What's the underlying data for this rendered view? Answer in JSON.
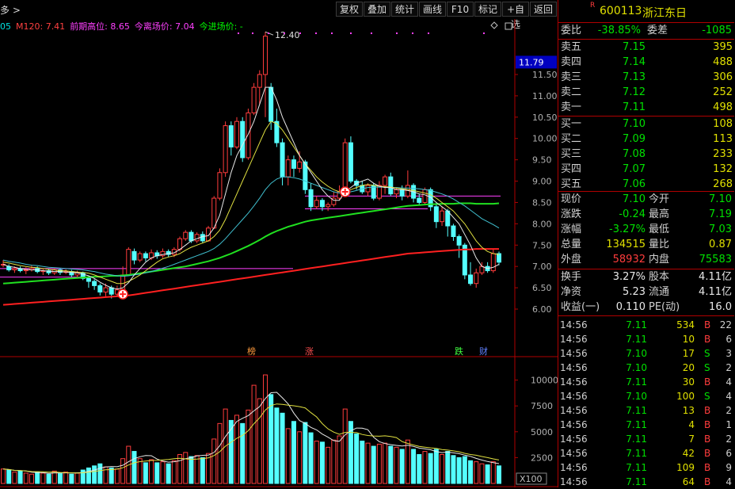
{
  "toolbar": {
    "left_text": "多 >",
    "buttons": [
      "复权",
      "叠加",
      "统计",
      "画线",
      "F10",
      "标记",
      "+自选",
      "返回"
    ]
  },
  "legend": [
    {
      "text": "05",
      "color": "#00e0e0"
    },
    {
      "text": "M120: 7.41",
      "color": "#ff4040"
    },
    {
      "text": "前期高位: 8.65",
      "color": "#ff40ff"
    },
    {
      "text": "今离场价: 7.04",
      "color": "#ff40ff"
    },
    {
      "text": "今进场价: -",
      "color": "#00ff00"
    }
  ],
  "main_chart": {
    "y_ticks": [
      11.5,
      11.0,
      10.5,
      10.0,
      9.5,
      9.0,
      8.5,
      8.0,
      7.5,
      7.0,
      6.5,
      6.0
    ],
    "current_price_label": "11.79",
    "peak_label": "12.40",
    "event_markers": [
      {
        "text": "榜",
        "color": "#ff9a3c"
      },
      {
        "text": "涨",
        "color": "#ff5050"
      },
      {
        "text": "跌",
        "color": "#40ff40"
      },
      {
        "text": "财",
        "color": "#6080ff"
      }
    ],
    "candles": [
      [
        7.05,
        7.05,
        7.15,
        6.98
      ],
      [
        7.0,
        6.92,
        7.05,
        6.88
      ],
      [
        6.92,
        6.95,
        7.0,
        6.85
      ],
      [
        6.95,
        6.9,
        7.0,
        6.86
      ],
      [
        6.9,
        6.92,
        6.98,
        6.82
      ],
      [
        6.92,
        6.95,
        7.02,
        6.88
      ],
      [
        6.95,
        6.88,
        7.0,
        6.84
      ],
      [
        6.88,
        6.9,
        6.95,
        6.8
      ],
      [
        6.9,
        6.85,
        6.95,
        6.8
      ],
      [
        6.85,
        6.92,
        6.97,
        6.8
      ],
      [
        6.92,
        6.86,
        6.95,
        6.8
      ],
      [
        6.86,
        6.88,
        6.93,
        6.82
      ],
      [
        6.88,
        6.8,
        6.92,
        6.75
      ],
      [
        6.8,
        6.85,
        6.9,
        6.74
      ],
      [
        6.85,
        6.72,
        6.88,
        6.68
      ],
      [
        6.72,
        6.65,
        6.78,
        6.5
      ],
      [
        6.65,
        6.55,
        6.7,
        6.45
      ],
      [
        6.55,
        6.4,
        6.6,
        6.32
      ],
      [
        6.4,
        6.5,
        6.6,
        6.3
      ],
      [
        6.5,
        6.35,
        6.55,
        6.25
      ],
      [
        6.35,
        6.45,
        6.55,
        6.3
      ],
      [
        6.45,
        6.8,
        7.0,
        6.4
      ],
      [
        6.8,
        7.4,
        7.45,
        6.78
      ],
      [
        7.35,
        7.15,
        7.42,
        7.05
      ],
      [
        7.15,
        7.3,
        7.35,
        7.1
      ],
      [
        7.3,
        7.2,
        7.35,
        7.12
      ],
      [
        7.2,
        7.32,
        7.4,
        7.15
      ],
      [
        7.32,
        7.25,
        7.38,
        7.18
      ],
      [
        7.25,
        7.35,
        7.42,
        7.2
      ],
      [
        7.35,
        7.28,
        7.4,
        7.22
      ],
      [
        7.28,
        7.4,
        7.45,
        7.22
      ],
      [
        7.4,
        7.65,
        7.7,
        7.35
      ],
      [
        7.65,
        7.8,
        7.85,
        7.6
      ],
      [
        7.8,
        7.6,
        7.85,
        7.55
      ],
      [
        7.6,
        7.75,
        7.8,
        7.55
      ],
      [
        7.75,
        7.6,
        7.82,
        7.55
      ],
      [
        7.6,
        7.9,
        7.95,
        7.58
      ],
      [
        7.9,
        8.6,
        8.65,
        7.88
      ],
      [
        8.6,
        9.2,
        9.3,
        8.55
      ],
      [
        9.2,
        10.3,
        10.4,
        9.1
      ],
      [
        10.3,
        9.8,
        10.4,
        9.6
      ],
      [
        9.8,
        10.4,
        10.5,
        9.75
      ],
      [
        10.4,
        9.55,
        10.5,
        9.45
      ],
      [
        9.55,
        10.6,
        10.7,
        9.5
      ],
      [
        10.6,
        11.2,
        11.3,
        10.55
      ],
      [
        11.2,
        11.5,
        11.6,
        10.8
      ],
      [
        11.5,
        12.4,
        12.5,
        10.5
      ],
      [
        11.2,
        10.4,
        11.3,
        10.2
      ],
      [
        10.4,
        9.9,
        10.7,
        9.8
      ],
      [
        9.9,
        9.1,
        10.0,
        8.9
      ],
      [
        9.1,
        9.5,
        9.6,
        8.9
      ],
      [
        9.5,
        9.3,
        9.6,
        9.1
      ],
      [
        9.3,
        9.45,
        9.7,
        9.2
      ],
      [
        9.45,
        8.8,
        9.5,
        8.7
      ],
      [
        8.8,
        8.4,
        8.95,
        8.3
      ],
      [
        8.4,
        8.55,
        8.65,
        8.35
      ],
      [
        8.55,
        8.4,
        8.6,
        8.3
      ],
      [
        8.4,
        8.45,
        8.5,
        8.3
      ],
      [
        8.45,
        8.6,
        8.75,
        8.4
      ],
      [
        8.6,
        8.75,
        8.9,
        8.55
      ],
      [
        8.75,
        9.9,
        10.0,
        8.7
      ],
      [
        9.9,
        9.0,
        10.05,
        8.95
      ],
      [
        9.0,
        8.9,
        9.05,
        8.8
      ],
      [
        8.9,
        8.75,
        9.0,
        8.7
      ],
      [
        8.75,
        8.9,
        8.95,
        8.65
      ],
      [
        8.9,
        8.6,
        8.95,
        8.55
      ],
      [
        8.6,
        8.9,
        9.0,
        8.55
      ],
      [
        8.9,
        9.1,
        9.15,
        8.7
      ],
      [
        9.1,
        8.7,
        9.2,
        8.65
      ],
      [
        8.7,
        8.8,
        8.85,
        8.6
      ],
      [
        8.8,
        8.65,
        8.9,
        8.55
      ],
      [
        8.65,
        8.9,
        9.25,
        8.6
      ],
      [
        8.9,
        8.6,
        8.95,
        8.5
      ],
      [
        8.6,
        8.5,
        8.7,
        8.45
      ],
      [
        8.5,
        8.8,
        8.85,
        8.45
      ],
      [
        8.8,
        8.4,
        8.85,
        8.3
      ],
      [
        8.4,
        8.05,
        8.5,
        7.9
      ],
      [
        8.05,
        8.3,
        8.4,
        7.95
      ],
      [
        8.3,
        7.95,
        8.35,
        7.7
      ],
      [
        7.95,
        7.7,
        8.0,
        7.6
      ],
      [
        7.7,
        7.5,
        7.75,
        7.2
      ],
      [
        7.5,
        6.8,
        7.55,
        6.7
      ],
      [
        6.8,
        6.6,
        7.1,
        6.55
      ],
      [
        6.6,
        6.85,
        6.95,
        6.5
      ],
      [
        6.85,
        7.0,
        7.1,
        6.8
      ],
      [
        7.0,
        6.9,
        7.1,
        6.85
      ],
      [
        6.9,
        7.3,
        7.42,
        6.85
      ],
      [
        7.3,
        7.1,
        7.35,
        7.03
      ]
    ],
    "ma_white": [
      7.05,
      7.0,
      6.98,
      6.95,
      6.93,
      6.92,
      6.92,
      6.9,
      6.89,
      6.88,
      6.88,
      6.87,
      6.86,
      6.85,
      6.82,
      6.78,
      6.72,
      6.63,
      6.56,
      6.5,
      6.47,
      6.5,
      6.62,
      6.8,
      6.95,
      7.1,
      7.2,
      7.25,
      7.28,
      7.3,
      7.32,
      7.4,
      7.5,
      7.6,
      7.65,
      7.7,
      7.72,
      7.9,
      8.2,
      8.7,
      9.2,
      9.6,
      9.85,
      10.1,
      10.4,
      10.8,
      11.2,
      11.2,
      10.9,
      10.5,
      10.2,
      9.9,
      9.6,
      9.4,
      9.2,
      9.0,
      8.8,
      8.65,
      8.55,
      8.55,
      8.75,
      8.85,
      8.95,
      9.0,
      9.05,
      8.95,
      8.88,
      8.85,
      8.85,
      8.8,
      8.8,
      8.78,
      8.75,
      8.7,
      8.68,
      8.62,
      8.5,
      8.4,
      8.3,
      8.15,
      8.0,
      7.75,
      7.5,
      7.2,
      7.0,
      6.95,
      6.98,
      7.05
    ],
    "ma_yellow": [
      7.1,
      7.08,
      7.05,
      7.02,
      7.0,
      6.98,
      6.97,
      6.95,
      6.93,
      6.92,
      6.9,
      6.9,
      6.88,
      6.87,
      6.86,
      6.84,
      6.8,
      6.75,
      6.7,
      6.65,
      6.6,
      6.6,
      6.65,
      6.72,
      6.8,
      6.9,
      7.0,
      7.1,
      7.18,
      7.22,
      7.25,
      7.3,
      7.38,
      7.45,
      7.5,
      7.55,
      7.6,
      7.7,
      7.85,
      8.1,
      8.4,
      8.7,
      9.0,
      9.3,
      9.6,
      9.9,
      10.2,
      10.4,
      10.35,
      10.2,
      10.0,
      9.8,
      9.6,
      9.4,
      9.25,
      9.1,
      8.98,
      8.88,
      8.8,
      8.75,
      8.78,
      8.8,
      8.85,
      8.9,
      8.92,
      8.9,
      8.88,
      8.87,
      8.86,
      8.84,
      8.82,
      8.8,
      8.78,
      8.75,
      8.72,
      8.68,
      8.6,
      8.5,
      8.4,
      8.3,
      8.15,
      8.0,
      7.8,
      7.6,
      7.45,
      7.35,
      7.3,
      7.28
    ],
    "ma_cyan": [
      7.15,
      7.12,
      7.1,
      7.08,
      7.05,
      7.03,
      7.02,
      7.0,
      6.98,
      6.97,
      6.96,
      6.95,
      6.94,
      6.93,
      6.92,
      6.9,
      6.88,
      6.85,
      6.82,
      6.8,
      6.78,
      6.77,
      6.78,
      6.8,
      6.82,
      6.85,
      6.88,
      6.92,
      6.96,
      7.0,
      7.05,
      7.1,
      7.15,
      7.2,
      7.25,
      7.3,
      7.35,
      7.42,
      7.52,
      7.65,
      7.8,
      7.95,
      8.1,
      8.25,
      8.42,
      8.6,
      8.8,
      8.95,
      9.05,
      9.1,
      9.1,
      9.08,
      9.05,
      9.0,
      8.95,
      8.9,
      8.85,
      8.8,
      8.75,
      8.72,
      8.72,
      8.75,
      8.78,
      8.82,
      8.85,
      8.86,
      8.86,
      8.86,
      8.85,
      8.85,
      8.84,
      8.84,
      8.83,
      8.82,
      8.8,
      8.78,
      8.74,
      8.7,
      8.65,
      8.58,
      8.5,
      8.42,
      8.32,
      8.22,
      8.12,
      8.05,
      7.98,
      7.9
    ],
    "ma_green": [
      6.6,
      6.61,
      6.62,
      6.63,
      6.64,
      6.65,
      6.66,
      6.67,
      6.68,
      6.69,
      6.7,
      6.71,
      6.72,
      6.73,
      6.74,
      6.75,
      6.76,
      6.76,
      6.77,
      6.78,
      6.78,
      6.79,
      6.8,
      6.82,
      6.84,
      6.86,
      6.88,
      6.9,
      6.92,
      6.94,
      6.96,
      6.98,
      7.0,
      7.03,
      7.06,
      7.09,
      7.12,
      7.16,
      7.2,
      7.25,
      7.3,
      7.36,
      7.42,
      7.48,
      7.55,
      7.62,
      7.7,
      7.77,
      7.83,
      7.88,
      7.93,
      7.97,
      8.01,
      8.05,
      8.08,
      8.1,
      8.12,
      8.14,
      8.16,
      8.18,
      8.2,
      8.22,
      8.24,
      8.26,
      8.28,
      8.3,
      8.32,
      8.34,
      8.36,
      8.38,
      8.4,
      8.42,
      8.43,
      8.44,
      8.45,
      8.46,
      8.46,
      8.47,
      8.47,
      8.47,
      8.48,
      8.48,
      8.48,
      8.47,
      8.47,
      8.47,
      8.47,
      8.48
    ],
    "ma_red": [
      6.1,
      6.11,
      6.12,
      6.13,
      6.14,
      6.15,
      6.16,
      6.17,
      6.18,
      6.19,
      6.2,
      6.21,
      6.22,
      6.23,
      6.24,
      6.25,
      6.26,
      6.27,
      6.28,
      6.29,
      6.3,
      6.31,
      6.32,
      6.34,
      6.36,
      6.38,
      6.4,
      6.42,
      6.44,
      6.46,
      6.48,
      6.5,
      6.52,
      6.54,
      6.56,
      6.58,
      6.6,
      6.62,
      6.64,
      6.66,
      6.68,
      6.7,
      6.72,
      6.74,
      6.76,
      6.78,
      6.8,
      6.82,
      6.84,
      6.86,
      6.88,
      6.9,
      6.92,
      6.94,
      6.96,
      6.98,
      7.0,
      7.02,
      7.04,
      7.06,
      7.08,
      7.1,
      7.12,
      7.14,
      7.16,
      7.18,
      7.2,
      7.22,
      7.24,
      7.26,
      7.28,
      7.3,
      7.31,
      7.32,
      7.33,
      7.34,
      7.35,
      7.36,
      7.37,
      7.38,
      7.39,
      7.4,
      7.4,
      7.41,
      7.41,
      7.41,
      7.41,
      7.41
    ]
  },
  "volume_chart": {
    "y_ticks": [
      10000,
      7500,
      5000,
      2500
    ],
    "unit_label": "X100",
    "values": [
      1400,
      1300,
      1100,
      1200,
      1000,
      900,
      1100,
      1000,
      900,
      1200,
      950,
      1100,
      900,
      1000,
      1300,
      1500,
      1700,
      1900,
      1600,
      1500,
      1400,
      2400,
      3600,
      3100,
      2400,
      2000,
      2300,
      2000,
      2100,
      1900,
      2200,
      2800,
      3000,
      2600,
      2700,
      2500,
      2900,
      4300,
      5800,
      7200,
      6100,
      6600,
      5800,
      7100,
      9500,
      8200,
      10500,
      8600,
      7300,
      6800,
      5300,
      6000,
      5000,
      5900,
      4900,
      4100,
      4000,
      3500,
      4200,
      4600,
      7200,
      6000,
      4800,
      4100,
      3900,
      3600,
      3800,
      3900,
      3600,
      3500,
      3300,
      4200,
      3300,
      2800,
      3100,
      2900,
      3300,
      2800,
      3100,
      2700,
      2500,
      2600,
      2200,
      2100,
      1900,
      1800,
      2100,
      1700
    ]
  },
  "quote": {
    "code": "600113",
    "name": "浙江东日",
    "tag": "R",
    "webi": {
      "label": "委比",
      "value": "-38.85%",
      "label2": "委差",
      "value2": "-1085"
    },
    "asks": [
      {
        "l": "卖五",
        "p": "7.15",
        "v": "395"
      },
      {
        "l": "卖四",
        "p": "7.14",
        "v": "488"
      },
      {
        "l": "卖三",
        "p": "7.13",
        "v": "306"
      },
      {
        "l": "卖二",
        "p": "7.12",
        "v": "252"
      },
      {
        "l": "卖一",
        "p": "7.11",
        "v": "498"
      }
    ],
    "bids": [
      {
        "l": "买一",
        "p": "7.10",
        "v": "108"
      },
      {
        "l": "买二",
        "p": "7.09",
        "v": "113"
      },
      {
        "l": "买三",
        "p": "7.08",
        "v": "233"
      },
      {
        "l": "买四",
        "p": "7.07",
        "v": "132"
      },
      {
        "l": "买五",
        "p": "7.06",
        "v": "268"
      }
    ],
    "stats": [
      {
        "l": "现价",
        "v": "7.10",
        "c": "green",
        "l2": "今开",
        "v2": "7.10",
        "c2": "green"
      },
      {
        "l": "涨跌",
        "v": "-0.24",
        "c": "green",
        "l2": "最高",
        "v2": "7.19",
        "c2": "green"
      },
      {
        "l": "涨幅",
        "v": "-3.27%",
        "c": "green",
        "l2": "最低",
        "v2": "7.03",
        "c2": "green"
      },
      {
        "l": "总量",
        "v": "134515",
        "c": "yel",
        "l2": "量比",
        "v2": "0.87",
        "c2": "yel"
      },
      {
        "l": "外盘",
        "v": "58932",
        "c": "red",
        "l2": "内盘",
        "v2": "75583",
        "c2": "green"
      }
    ],
    "stats2": [
      {
        "l": "换手",
        "v": "3.27%",
        "c": "wh",
        "l2": "股本",
        "v2": "4.11亿",
        "c2": "wh"
      },
      {
        "l": "净资",
        "v": "5.23",
        "c": "wh",
        "l2": "流通",
        "v2": "4.11亿",
        "c2": "wh"
      },
      {
        "l": "收益(一)",
        "v": "0.110",
        "c": "wh",
        "l2": "PE(动)",
        "v2": "16.0",
        "c2": "wh"
      }
    ],
    "ticks": [
      {
        "t": "14:56",
        "p": "7.11",
        "v": "534",
        "bs": "B",
        "n": "22",
        "vc": "mag"
      },
      {
        "t": "14:56",
        "p": "7.11",
        "v": "10",
        "bs": "B",
        "n": "6"
      },
      {
        "t": "14:56",
        "p": "7.10",
        "v": "17",
        "bs": "S",
        "n": "3"
      },
      {
        "t": "14:56",
        "p": "7.10",
        "v": "20",
        "bs": "S",
        "n": "2"
      },
      {
        "t": "14:56",
        "p": "7.11",
        "v": "30",
        "bs": "B",
        "n": "4"
      },
      {
        "t": "14:56",
        "p": "7.10",
        "v": "100",
        "bs": "S",
        "n": "4"
      },
      {
        "t": "14:56",
        "p": "7.11",
        "v": "13",
        "bs": "B",
        "n": "2"
      },
      {
        "t": "14:56",
        "p": "7.11",
        "v": "4",
        "bs": "B",
        "n": "1"
      },
      {
        "t": "14:56",
        "p": "7.11",
        "v": "7",
        "bs": "B",
        "n": "2"
      },
      {
        "t": "14:56",
        "p": "7.11",
        "v": "42",
        "bs": "B",
        "n": "6"
      },
      {
        "t": "14:56",
        "p": "7.11",
        "v": "109",
        "bs": "B",
        "n": "9"
      },
      {
        "t": "14:56",
        "p": "7.11",
        "v": "64",
        "bs": "B",
        "n": "4"
      }
    ]
  }
}
